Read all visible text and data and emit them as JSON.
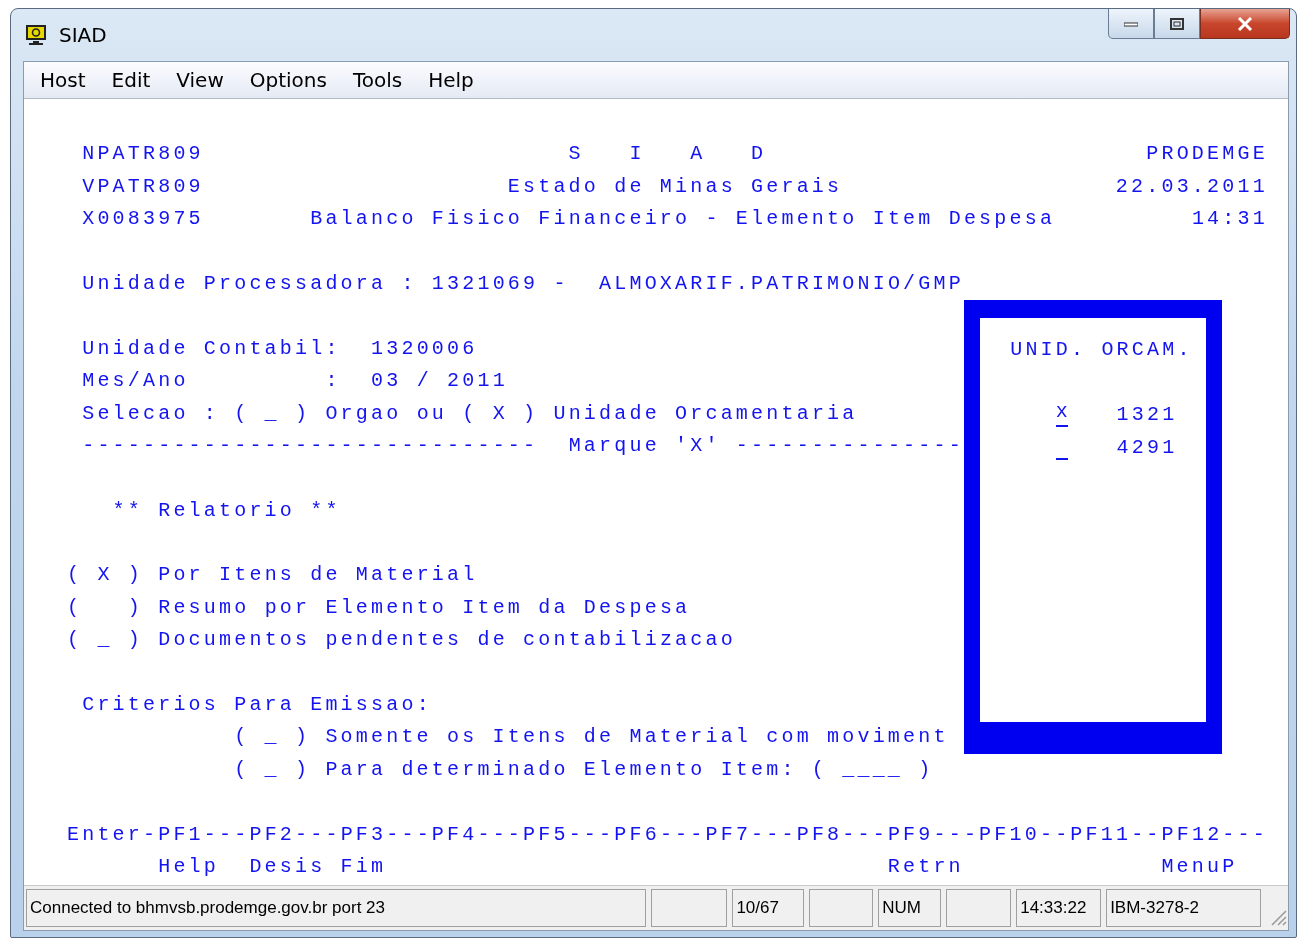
{
  "window": {
    "title": "SIAD"
  },
  "menu": [
    {
      "label": "Host"
    },
    {
      "label": "Edit"
    },
    {
      "label": "View"
    },
    {
      "label": "Options"
    },
    {
      "label": "Tools"
    },
    {
      "label": "Help"
    }
  ],
  "screen": {
    "lines": [
      {
        "kind": "blank"
      },
      {
        "kind": "text",
        "segments": [
          " NPATR809",
          "                        S   I   A   D",
          "                         PRODEMGE"
        ]
      },
      {
        "kind": "text",
        "segments": [
          " VPATR809",
          "                    Estado de Minas Gerais",
          "                  22.03.2011"
        ]
      },
      {
        "kind": "text",
        "segments": [
          " X0083975",
          "       Balanco Fisico Financeiro - Elemento Item Despesa",
          "         14:31"
        ]
      },
      {
        "kind": "blank"
      },
      {
        "kind": "text",
        "segments": [
          " Unidade Processadora : 1321069 -  ALMOXARIF.PATRIMONIO/GMP"
        ]
      },
      {
        "kind": "blank"
      },
      {
        "kind": "text",
        "segments": [
          " Unidade Contabil:  1320006"
        ]
      },
      {
        "kind": "text",
        "segments": [
          " Mes/Ano         :  03 / 2011"
        ]
      },
      {
        "kind": "text",
        "segments": [
          " Selecao : ( _ ) Orgao ou ( X ) Unidade Orcamentaria"
        ]
      },
      {
        "kind": "text",
        "segments": [
          " ------------------------------",
          "  Marque 'X'",
          " ---------------"
        ]
      },
      {
        "kind": "blank"
      },
      {
        "kind": "text",
        "segments": [
          "   ** Relatorio **"
        ]
      },
      {
        "kind": "blank"
      },
      {
        "kind": "text",
        "segments": [
          "( X ) Por Itens de Material"
        ]
      },
      {
        "kind": "text",
        "segments": [
          "(   ) Resumo por Elemento Item da Despesa"
        ]
      },
      {
        "kind": "text",
        "segments": [
          "( _ ) Documentos pendentes de contabilizacao"
        ]
      },
      {
        "kind": "blank"
      },
      {
        "kind": "text",
        "segments": [
          " Criterios Para Emissao:"
        ]
      },
      {
        "kind": "text",
        "segments": [
          "           ( _ ) Somente os Itens de Material com moviment"
        ]
      },
      {
        "kind": "text",
        "segments": [
          "           ( _ ) Para determinado Elemento Item: ( ____ )"
        ]
      },
      {
        "kind": "blank"
      },
      {
        "kind": "text",
        "segments": [
          "Enter-PF1---PF2---PF3---PF4---PF5---PF6---PF7---PF8---PF9---PF10--PF11--PF12---"
        ]
      },
      {
        "kind": "text",
        "segments": [
          "      Help",
          "  Desis",
          " Fim",
          "                                 Retrn",
          "             MenuP"
        ]
      }
    ]
  },
  "popup": {
    "header": "UNID. ORCAM.",
    "items": [
      {
        "entry": "x",
        "code": "1321"
      },
      {
        "code": "4291"
      }
    ]
  },
  "status_bar": [
    {
      "kind": "text",
      "text": "Connected to bhmvsb.prodemge.gov.br port 23"
    },
    {
      "kind": "empty"
    },
    {
      "kind": "text",
      "text": "10/67"
    },
    {
      "kind": "empty"
    },
    {
      "kind": "text",
      "text": "NUM"
    },
    {
      "kind": "empty"
    },
    {
      "kind": "text",
      "text": "14:33:22"
    },
    {
      "kind": "text",
      "text": "IBM-3278-2"
    }
  ]
}
